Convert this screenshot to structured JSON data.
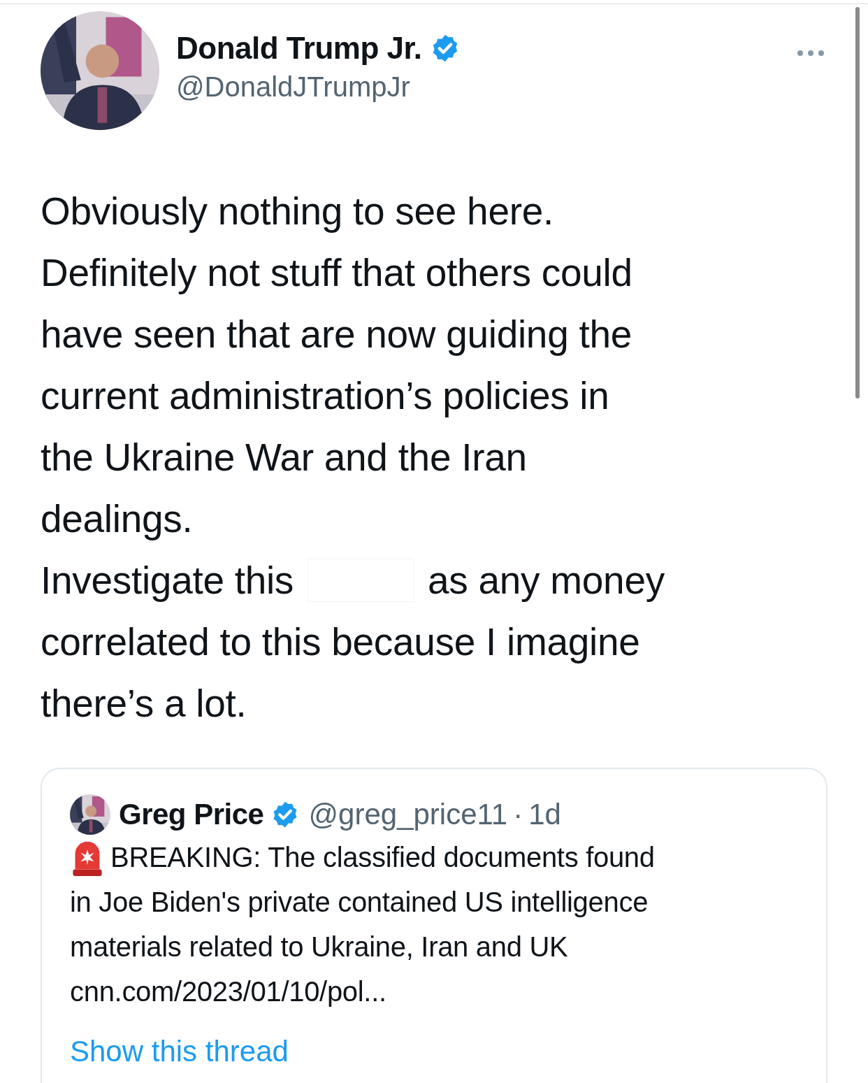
{
  "author": {
    "name": "Donald Trump Jr.",
    "handle": "@DonaldJTrumpJr",
    "verified": true
  },
  "lines": [
    {
      "kind": "plain",
      "text": "Obviously nothing to see here."
    },
    {
      "kind": "plain",
      "text": "Definitely not stuff that others could"
    },
    {
      "kind": "plain",
      "text": "have seen that are now guiding the"
    },
    {
      "kind": "plain",
      "text": "current administration’s policies in"
    },
    {
      "kind": "plain",
      "text": "the Ukraine War and the Iran"
    },
    {
      "kind": "plain",
      "text": "dealings."
    },
    {
      "kind": "covered",
      "before": "Investigate this",
      "after": "as any money"
    },
    {
      "kind": "plain",
      "text": "correlated to this because I imagine"
    },
    {
      "kind": "plain",
      "text": "there’s a lot."
    }
  ],
  "quote": {
    "author": {
      "name": "Greg Price",
      "handle": "@greg_price11",
      "verified": true
    },
    "separator": "·",
    "time": "1d",
    "lines": [
      "BREAKING: The classified documents found",
      "in Joe Biden's private contained US intelligence",
      "materials related to Ukraine, Iran and UK"
    ],
    "link": "cnn.com/2023/01/10/pol...",
    "thread_link": "Show this thread"
  }
}
